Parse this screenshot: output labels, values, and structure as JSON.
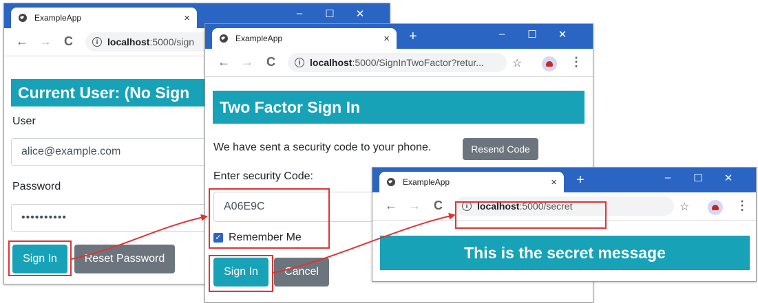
{
  "window1": {
    "tab_title": "ExampleApp",
    "tab_close": "×",
    "url_host": "localhost",
    "url_rest": ":5000/sign",
    "heading": "Current User: (No Sign",
    "user_label": "User",
    "user_value": "alice@example.com",
    "password_label": "Password",
    "password_value": "••••••••••",
    "signin_label": "Sign In",
    "reset_label": "Reset Password"
  },
  "window2": {
    "tab_title": "ExampleApp",
    "tab_close": "×",
    "newtab": "+",
    "url_host": "localhost",
    "url_rest": ":5000/SignInTwoFactor?retur...",
    "heading": "Two Factor Sign In",
    "sent_text": "We have sent a security code to your phone.",
    "resend_label": "Resend Code",
    "code_label": "Enter security Code:",
    "code_value": "A06E9C",
    "remember_label": "Remember Me",
    "signin_label": "Sign In",
    "cancel_label": "Cancel"
  },
  "window3": {
    "tab_title": "ExampleApp",
    "tab_close": "×",
    "newtab": "+",
    "url_host": "localhost",
    "url_rest": ":5000/secret",
    "message": "This is the secret message"
  },
  "glyphs": {
    "back": "←",
    "forward": "→",
    "reload": "C",
    "info": "i",
    "star": "☆",
    "menu": "⋮",
    "minimize": "–",
    "maximize": "☐",
    "close": "✕",
    "check": "✓"
  },
  "colors": {
    "titlebar": "#2b65c4",
    "heading": "#17a2b8",
    "primary_button": "#17a2b8",
    "secondary_button": "#6c757d",
    "highlight": "#e03434"
  }
}
